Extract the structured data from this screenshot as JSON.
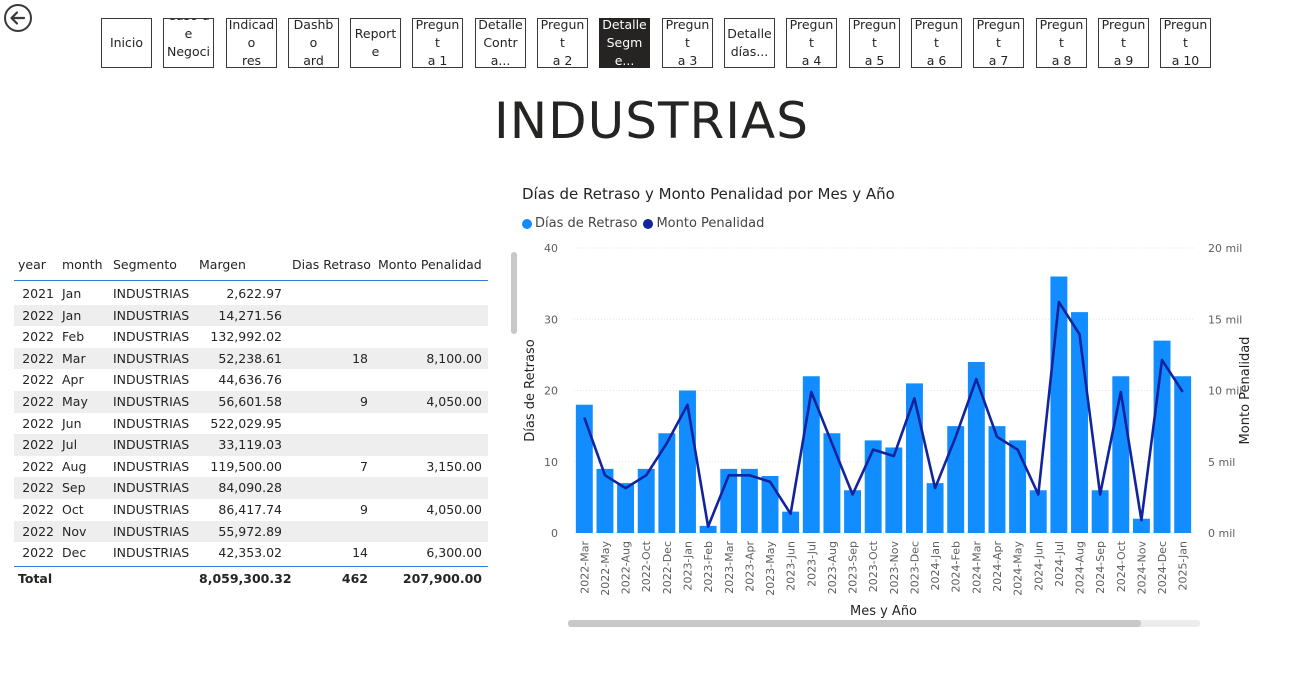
{
  "nav": {
    "back_icon": "back-arrow-icon",
    "buttons": [
      {
        "label": "Inicio",
        "active": false
      },
      {
        "label": "Caso de\nNegocio",
        "active": false
      },
      {
        "label": "Indicado\nres",
        "active": false
      },
      {
        "label": "Dashbo\nard",
        "active": false
      },
      {
        "label": "Reporte",
        "active": false
      },
      {
        "label": "Pregunt\na 1",
        "active": false
      },
      {
        "label": "Detalle\nContra...",
        "active": false
      },
      {
        "label": "Pregunt\na 2",
        "active": false
      },
      {
        "label": "Detalle\nSegme...",
        "active": true
      },
      {
        "label": "Pregunt\na 3",
        "active": false
      },
      {
        "label": "Detalle\ndías...",
        "active": false
      },
      {
        "label": "Pregunt\na 4",
        "active": false
      },
      {
        "label": "Pregunt\na 5",
        "active": false
      },
      {
        "label": "Pregunt\na 6",
        "active": false
      },
      {
        "label": "Pregunt\na 7",
        "active": false
      },
      {
        "label": "Pregunt\na 8",
        "active": false
      },
      {
        "label": "Pregunt\na 9",
        "active": false
      },
      {
        "label": "Pregunt\na 10",
        "active": false
      }
    ]
  },
  "page_title": "INDUSTRIAS",
  "table": {
    "headers": {
      "year": "year",
      "month": "month",
      "segment": "Segmento",
      "margin": "Margen",
      "dias": "Dias Retraso",
      "monto": "Monto Penalidad"
    },
    "rows": [
      {
        "year": "2021",
        "month": "Jan",
        "segment": "INDUSTRIAS",
        "margin": "2,622.97",
        "dias": "",
        "monto": ""
      },
      {
        "year": "2022",
        "month": "Jan",
        "segment": "INDUSTRIAS",
        "margin": "14,271.56",
        "dias": "",
        "monto": ""
      },
      {
        "year": "2022",
        "month": "Feb",
        "segment": "INDUSTRIAS",
        "margin": "132,992.02",
        "dias": "",
        "monto": ""
      },
      {
        "year": "2022",
        "month": "Mar",
        "segment": "INDUSTRIAS",
        "margin": "52,238.61",
        "dias": "18",
        "monto": "8,100.00"
      },
      {
        "year": "2022",
        "month": "Apr",
        "segment": "INDUSTRIAS",
        "margin": "44,636.76",
        "dias": "",
        "monto": ""
      },
      {
        "year": "2022",
        "month": "May",
        "segment": "INDUSTRIAS",
        "margin": "56,601.58",
        "dias": "9",
        "monto": "4,050.00"
      },
      {
        "year": "2022",
        "month": "Jun",
        "segment": "INDUSTRIAS",
        "margin": "522,029.95",
        "dias": "",
        "monto": ""
      },
      {
        "year": "2022",
        "month": "Jul",
        "segment": "INDUSTRIAS",
        "margin": "33,119.03",
        "dias": "",
        "monto": ""
      },
      {
        "year": "2022",
        "month": "Aug",
        "segment": "INDUSTRIAS",
        "margin": "119,500.00",
        "dias": "7",
        "monto": "3,150.00"
      },
      {
        "year": "2022",
        "month": "Sep",
        "segment": "INDUSTRIAS",
        "margin": "84,090.28",
        "dias": "",
        "monto": ""
      },
      {
        "year": "2022",
        "month": "Oct",
        "segment": "INDUSTRIAS",
        "margin": "86,417.74",
        "dias": "9",
        "monto": "4,050.00"
      },
      {
        "year": "2022",
        "month": "Nov",
        "segment": "INDUSTRIAS",
        "margin": "55,972.89",
        "dias": "",
        "monto": ""
      },
      {
        "year": "2022",
        "month": "Dec",
        "segment": "INDUSTRIAS",
        "margin": "42,353.02",
        "dias": "14",
        "monto": "6,300.00"
      }
    ],
    "total": {
      "label": "Total",
      "margin": "8,059,300.32",
      "dias": "462",
      "monto": "207,900.00"
    }
  },
  "chart_data": {
    "type": "bar",
    "title": "Días de Retraso y Monto Penalidad por Mes y Año",
    "xlabel": "Mes y Año",
    "ylabel": "Días de Retraso",
    "y2label": "Monto Penalidad",
    "ylim": [
      0,
      40
    ],
    "y2lim": [
      0,
      20000
    ],
    "yticks": [
      "0",
      "10",
      "20",
      "30",
      "40"
    ],
    "y2ticks": [
      "0 mil",
      "5 mil",
      "10 mil",
      "15 mil",
      "20 mil"
    ],
    "legend_position": "top-left",
    "categories": [
      "2022-Mar",
      "2022-May",
      "2022-Aug",
      "2022-Oct",
      "2022-Dec",
      "2023-Jan",
      "2023-Feb",
      "2023-Mar",
      "2023-Apr",
      "2023-May",
      "2023-Jun",
      "2023-Jul",
      "2023-Aug",
      "2023-Sep",
      "2023-Oct",
      "2023-Nov",
      "2023-Dec",
      "2024-Jan",
      "2024-Feb",
      "2024-Mar",
      "2024-Apr",
      "2024-May",
      "2024-Jun",
      "2024-Jul",
      "2024-Aug",
      "2024-Sep",
      "2024-Oct",
      "2024-Nov",
      "2024-Dec",
      "2025-Jan"
    ],
    "series": [
      {
        "name": "Días de Retraso",
        "kind": "bar",
        "axis": "left",
        "color": "#118DFF",
        "values": [
          18,
          9,
          7,
          9,
          14,
          20,
          1,
          9,
          9,
          8,
          3,
          22,
          14,
          6,
          13,
          12,
          21,
          7,
          15,
          24,
          15,
          13,
          6,
          36,
          31,
          6,
          22,
          2,
          27,
          22
        ]
      },
      {
        "name": "Monto Penalidad",
        "kind": "line",
        "axis": "right",
        "color": "#12239E",
        "values": [
          8100,
          4050,
          3150,
          4050,
          6300,
          9000,
          450,
          4050,
          4050,
          3600,
          1350,
          9900,
          6300,
          2700,
          5850,
          5400,
          9450,
          3150,
          6750,
          10800,
          6750,
          5850,
          2700,
          16200,
          13950,
          2700,
          9900,
          900,
          12150,
          9900
        ]
      }
    ]
  }
}
